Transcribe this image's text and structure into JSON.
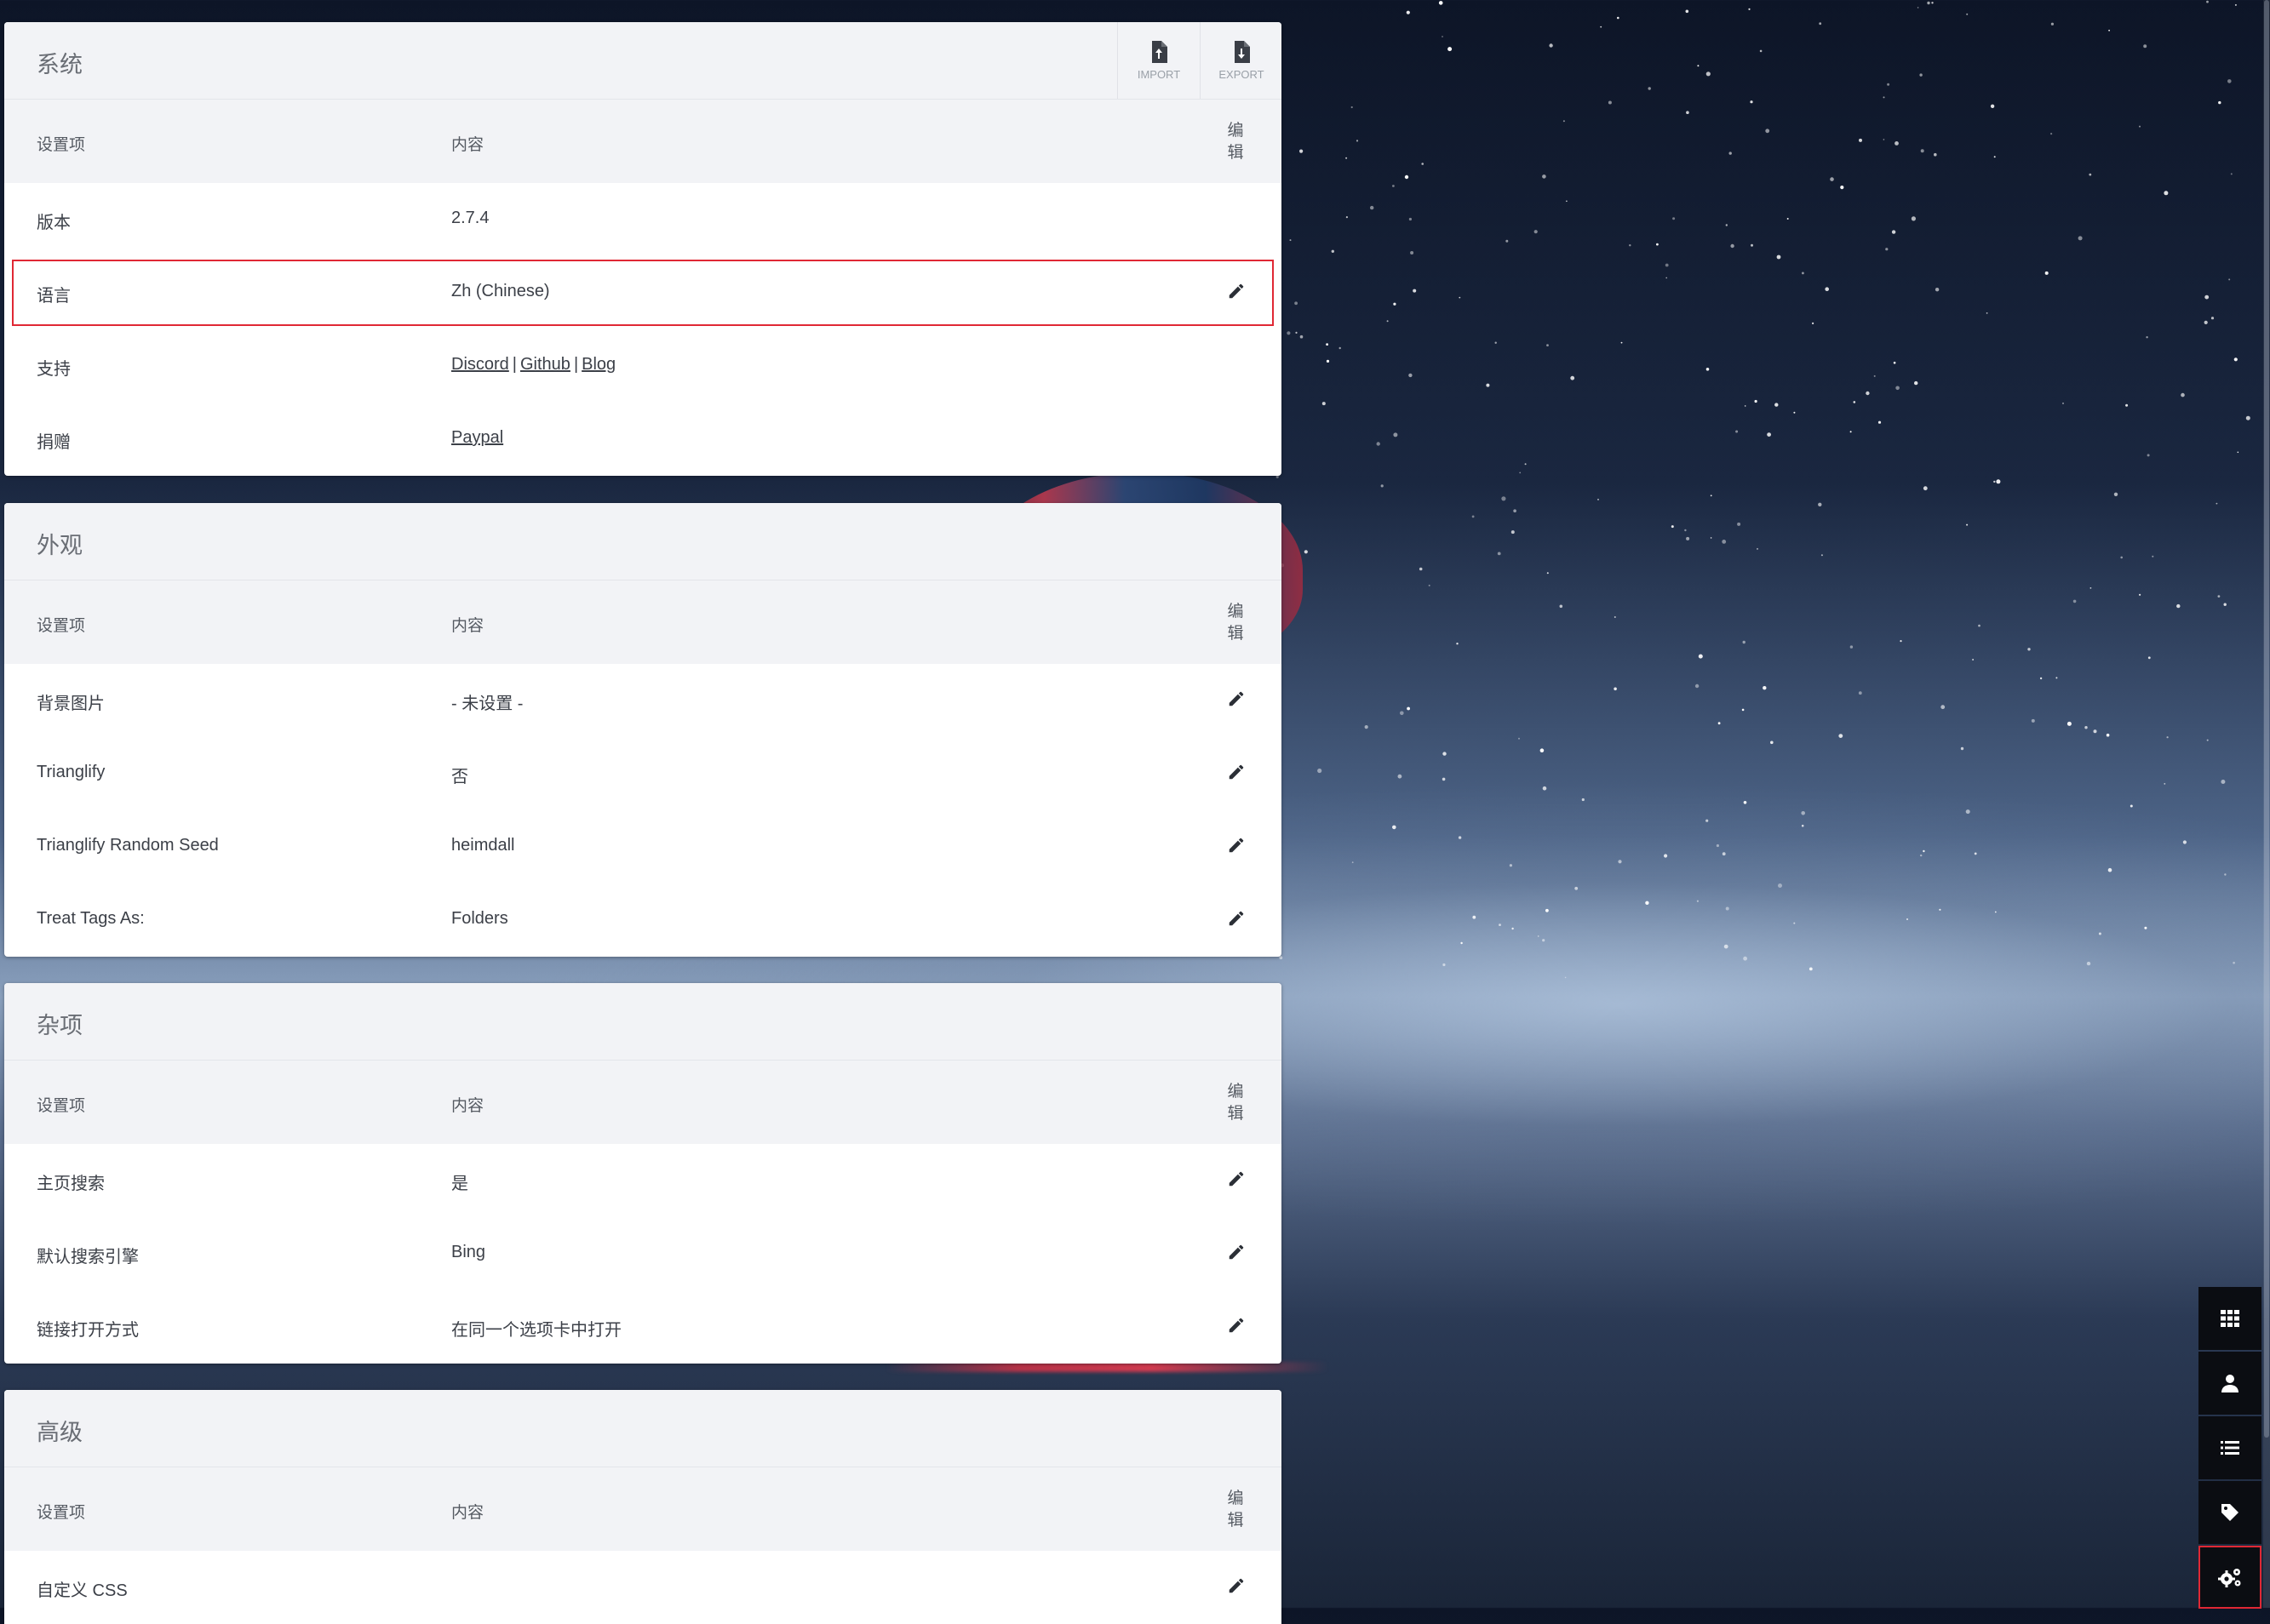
{
  "sections": [
    {
      "title": "系统",
      "header_buttons": [
        {
          "label": "IMPORT",
          "icon": "file-upload-icon"
        },
        {
          "label": "EXPORT",
          "icon": "file-download-icon"
        }
      ],
      "columns": {
        "setting": "设置项",
        "content": "内容",
        "edit": "编\n辑"
      },
      "rows": [
        {
          "key": "版本",
          "value": "2.7.4",
          "editable": false
        },
        {
          "key": "语言",
          "value": "Zh (Chinese)",
          "editable": true,
          "highlighted": true
        },
        {
          "key": "支持",
          "links": [
            "Discord",
            "Github",
            "Blog"
          ],
          "separator": "|",
          "editable": false
        },
        {
          "key": "捐赠",
          "links": [
            "Paypal"
          ],
          "editable": false
        }
      ]
    },
    {
      "title": "外观",
      "columns": {
        "setting": "设置项",
        "content": "内容",
        "edit": "编\n辑"
      },
      "rows": [
        {
          "key": "背景图片",
          "value": "- 未设置 -",
          "editable": true
        },
        {
          "key": "Trianglify",
          "value": "否",
          "editable": true
        },
        {
          "key": "Trianglify Random Seed",
          "value": "heimdall",
          "editable": true
        },
        {
          "key": "Treat Tags As:",
          "value": "Folders",
          "editable": true
        }
      ]
    },
    {
      "title": "杂项",
      "columns": {
        "setting": "设置项",
        "content": "内容",
        "edit": "编\n辑"
      },
      "rows": [
        {
          "key": "主页搜索",
          "value": "是",
          "editable": true
        },
        {
          "key": "默认搜索引擎",
          "value": "Bing",
          "editable": true
        },
        {
          "key": "链接打开方式",
          "value": "在同一个选项卡中打开",
          "editable": true
        }
      ]
    },
    {
      "title": "高级",
      "columns": {
        "setting": "设置项",
        "content": "内容",
        "edit": "编\n辑"
      },
      "rows": [
        {
          "key": "自定义 CSS",
          "value": "",
          "editable": true
        }
      ]
    }
  ],
  "dock": [
    {
      "icon": "grid-icon",
      "active": false
    },
    {
      "icon": "user-icon",
      "active": false
    },
    {
      "icon": "list-icon",
      "active": false
    },
    {
      "icon": "tag-icon",
      "active": false
    },
    {
      "icon": "cogs-icon",
      "active": true
    }
  ],
  "colors": {
    "highlight": "#e02834",
    "panel_header": "#f2f3f6",
    "dock": "#0b0d12"
  }
}
